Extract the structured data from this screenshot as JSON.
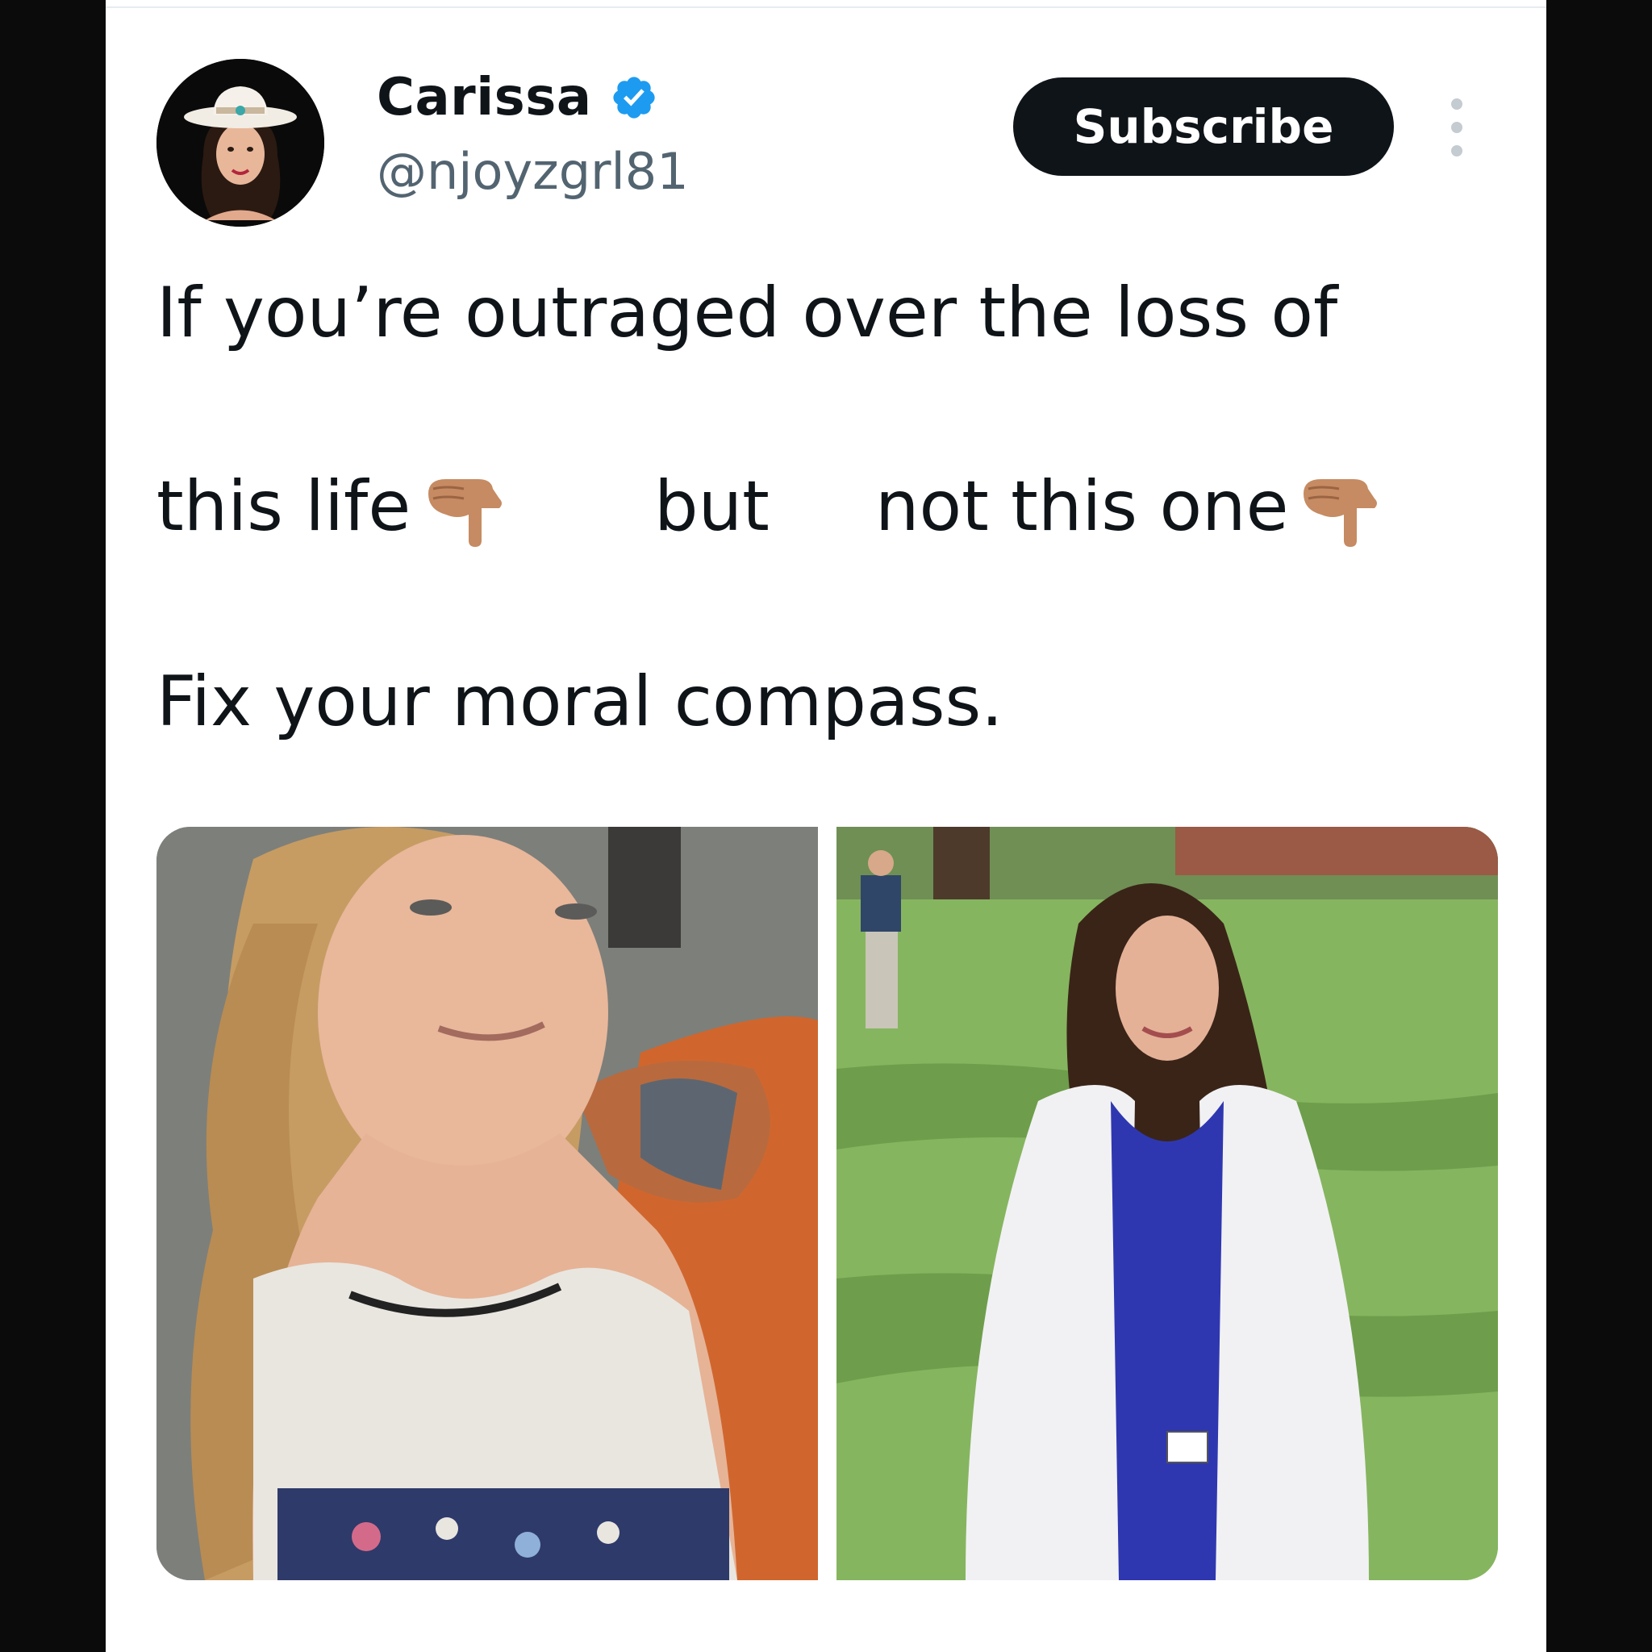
{
  "post": {
    "display_name": "Carissa",
    "handle": "@njoyzgrl81",
    "subscribe_label": "Subscribe",
    "verified_icon": "verified-badge-icon",
    "more_icon": "more-options-icon",
    "text": {
      "line1": "If you’re outraged over the loss of",
      "line2_a": "this life",
      "line2_b": "but",
      "line2_c": "not this one",
      "line3": "Fix your moral compass."
    },
    "emoji": "backhand-index-pointing-down-emoji"
  },
  "media": {
    "left_image": "photo of a smiling blonde woman",
    "right_image": "photo of a smiling woman in white coat and blue scrubs on a lawn"
  },
  "colors": {
    "text": "#0f1419",
    "secondary": "#536471",
    "verified": "#1d9bf0",
    "button_bg": "#0f1419",
    "page_bg": "#0b0b0b"
  }
}
